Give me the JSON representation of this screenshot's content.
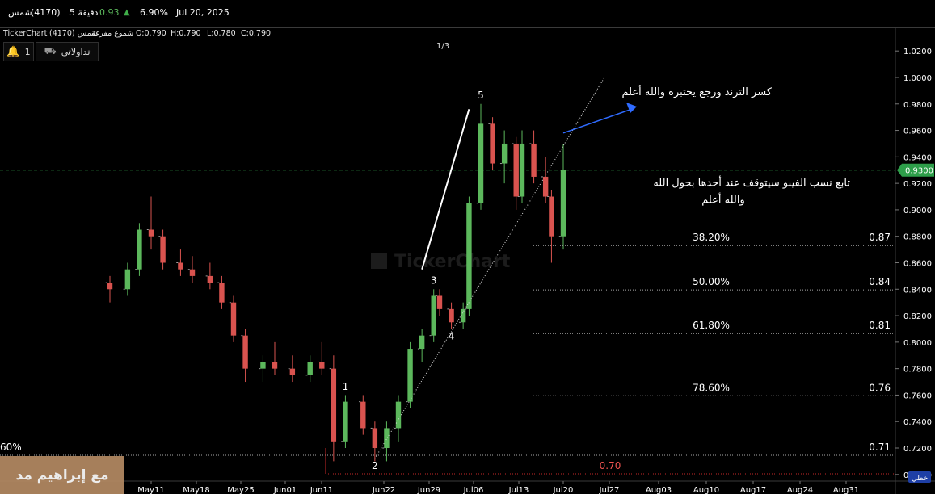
{
  "header": {
    "symbol": "شمس",
    "code": "(4170)",
    "interval": "5 دقيقة",
    "change": "0.93",
    "change_pct": "6.90%",
    "date": "Jul 20, 2025"
  },
  "info": {
    "brand": "TickerChart",
    "symbol_name": "شمس (4170)",
    "chart_style": "شموع مفرغة",
    "open": "O:0.790",
    "high": "H:0.790",
    "low": "L:0.780",
    "close": "C:0.790"
  },
  "toolbar": {
    "alerts_count": "1",
    "trade_label": "تداولاتي"
  },
  "page_indicator": "1/3",
  "watermark": "TickerChart",
  "author_badge": "مع إبراهيم مد",
  "annotations": {
    "trend_break": "كسر الترند ورجع يختبره والله أعلم",
    "fib_note_line1": "تابع نسب الفيبو  سيتوقف عند أحدها بحول الله",
    "fib_note_line2": "والله أعلم"
  },
  "colors": {
    "up": "#5cb85c",
    "down": "#d9534f",
    "neutral": "#9e9e9e",
    "price_tag": "#2e9e4a",
    "arrow": "#2f6bff",
    "fib_line": "#a8a8a8",
    "low_line": "#c62828"
  },
  "chart_data": {
    "type": "candlestick",
    "y_range": [
      0.695,
      1.025
    ],
    "y_ticks": [
      "1.0200",
      "1.0000",
      "0.9800",
      "0.9600",
      "0.9400",
      "0.9200",
      "0.9000",
      "0.8800",
      "0.8600",
      "0.8400",
      "0.8200",
      "0.8000",
      "0.7800",
      "0.7600",
      "0.7400",
      "0.7200",
      "0.7000"
    ],
    "x_ticks": [
      "May11",
      "May18",
      "May25",
      "Jun01",
      "Jun11",
      "Jun22",
      "Jun29",
      "Jul06",
      "Jul13",
      "Jul20",
      "Jul27",
      "Aug03",
      "Aug10",
      "Aug17",
      "Aug24",
      "Aug31"
    ],
    "last_price": "0.9300",
    "last_price_value": 0.93,
    "series": [
      {
        "period": "May04",
        "open": 0.845,
        "high": 0.85,
        "low": 0.83,
        "close": 0.84
      },
      {
        "period": "May07",
        "open": 0.84,
        "high": 0.86,
        "low": 0.835,
        "close": 0.855
      },
      {
        "period": "May09",
        "open": 0.855,
        "high": 0.89,
        "low": 0.85,
        "close": 0.885
      },
      {
        "period": "May11",
        "open": 0.885,
        "high": 0.91,
        "low": 0.87,
        "close": 0.88
      },
      {
        "period": "May13",
        "open": 0.88,
        "high": 0.885,
        "low": 0.855,
        "close": 0.86
      },
      {
        "period": "May16",
        "open": 0.86,
        "high": 0.87,
        "low": 0.85,
        "close": 0.855
      },
      {
        "period": "May18",
        "open": 0.855,
        "high": 0.865,
        "low": 0.845,
        "close": 0.85
      },
      {
        "period": "May21",
        "open": 0.85,
        "high": 0.86,
        "low": 0.84,
        "close": 0.845
      },
      {
        "period": "May23",
        "open": 0.845,
        "high": 0.85,
        "low": 0.825,
        "close": 0.83
      },
      {
        "period": "May25",
        "open": 0.83,
        "high": 0.835,
        "low": 0.8,
        "close": 0.805
      },
      {
        "period": "May27",
        "open": 0.805,
        "high": 0.81,
        "low": 0.77,
        "close": 0.78
      },
      {
        "period": "May30",
        "open": 0.78,
        "high": 0.79,
        "low": 0.77,
        "close": 0.785
      },
      {
        "period": "Jun01",
        "open": 0.785,
        "high": 0.8,
        "low": 0.775,
        "close": 0.78
      },
      {
        "period": "Jun04",
        "open": 0.78,
        "high": 0.79,
        "low": 0.77,
        "close": 0.775
      },
      {
        "period": "Jun07",
        "open": 0.775,
        "high": 0.79,
        "low": 0.77,
        "close": 0.785
      },
      {
        "period": "Jun09",
        "open": 0.785,
        "high": 0.8,
        "low": 0.775,
        "close": 0.78
      },
      {
        "period": "Jun11",
        "open": 0.78,
        "high": 0.79,
        "low": 0.71,
        "close": 0.725
      },
      {
        "period": "Jun13",
        "open": 0.725,
        "high": 0.76,
        "low": 0.72,
        "close": 0.755
      },
      {
        "period": "Jun16",
        "open": 0.755,
        "high": 0.76,
        "low": 0.73,
        "close": 0.735
      },
      {
        "period": "Jun18",
        "open": 0.735,
        "high": 0.74,
        "low": 0.71,
        "close": 0.72
      },
      {
        "period": "Jun20",
        "open": 0.72,
        "high": 0.74,
        "low": 0.71,
        "close": 0.735
      },
      {
        "period": "Jun22",
        "open": 0.735,
        "high": 0.76,
        "low": 0.725,
        "close": 0.755
      },
      {
        "period": "Jun24",
        "open": 0.755,
        "high": 0.8,
        "low": 0.75,
        "close": 0.795
      },
      {
        "period": "Jun26",
        "open": 0.795,
        "high": 0.81,
        "low": 0.785,
        "close": 0.805
      },
      {
        "period": "Jun28",
        "open": 0.805,
        "high": 0.84,
        "low": 0.8,
        "close": 0.835
      },
      {
        "period": "Jun29",
        "open": 0.835,
        "high": 0.84,
        "low": 0.82,
        "close": 0.825
      },
      {
        "period": "Jul01",
        "open": 0.825,
        "high": 0.83,
        "low": 0.81,
        "close": 0.815
      },
      {
        "period": "Jul03",
        "open": 0.815,
        "high": 0.83,
        "low": 0.81,
        "close": 0.825
      },
      {
        "period": "Jul04",
        "open": 0.825,
        "high": 0.91,
        "low": 0.82,
        "close": 0.905
      },
      {
        "period": "Jul06",
        "open": 0.905,
        "high": 0.98,
        "low": 0.9,
        "close": 0.965
      },
      {
        "period": "Jul08",
        "open": 0.965,
        "high": 0.97,
        "low": 0.93,
        "close": 0.935
      },
      {
        "period": "Jul10",
        "open": 0.935,
        "high": 0.96,
        "low": 0.92,
        "close": 0.95
      },
      {
        "period": "Jul12",
        "open": 0.95,
        "high": 0.955,
        "low": 0.9,
        "close": 0.91
      },
      {
        "period": "Jul13",
        "open": 0.91,
        "high": 0.96,
        "low": 0.905,
        "close": 0.95
      },
      {
        "period": "Jul15",
        "open": 0.95,
        "high": 0.96,
        "low": 0.92,
        "close": 0.925
      },
      {
        "period": "Jul17",
        "open": 0.925,
        "high": 0.94,
        "low": 0.905,
        "close": 0.91
      },
      {
        "period": "Jul18",
        "open": 0.91,
        "high": 0.915,
        "low": 0.86,
        "close": 0.88
      },
      {
        "period": "Jul20",
        "open": 0.88,
        "high": 0.95,
        "low": 0.87,
        "close": 0.93
      }
    ],
    "fib_levels": [
      {
        "pct": "38.20%",
        "value": "0.87",
        "price": 0.873
      },
      {
        "pct": "50.00%",
        "value": "0.84",
        "price": 0.8395
      },
      {
        "pct": "61.80%",
        "value": "0.81",
        "price": 0.8065
      },
      {
        "pct": "78.60%",
        "value": "0.76",
        "price": 0.7595
      },
      {
        "pct": "60%",
        "value": "0.71",
        "price": 0.7145
      }
    ],
    "low_level": {
      "value": "0.70",
      "price": 0.7005
    },
    "wave_labels": [
      {
        "text": "1",
        "period": "Jun13",
        "price": 0.764
      },
      {
        "text": "2",
        "period": "Jun18",
        "price": 0.704
      },
      {
        "text": "3",
        "period": "Jun28",
        "price": 0.844
      },
      {
        "text": "4",
        "period": "Jul01",
        "price": 0.802
      },
      {
        "text": "5",
        "period": "Jul06",
        "price": 0.984
      }
    ],
    "trendline": {
      "from": {
        "period": "Jun18",
        "price": 0.712
      },
      "to": {
        "period": "Jul27",
        "price": 1.0
      }
    },
    "impulse_line": {
      "from": {
        "period": "Jun26",
        "price": 0.855
      },
      "to": {
        "period": "Jul04",
        "price": 0.976
      }
    },
    "projection_arrow": {
      "from": {
        "period": "Jul20",
        "price": 0.958
      },
      "to": {
        "period": "Jul27",
        "price": 0.978
      }
    }
  }
}
